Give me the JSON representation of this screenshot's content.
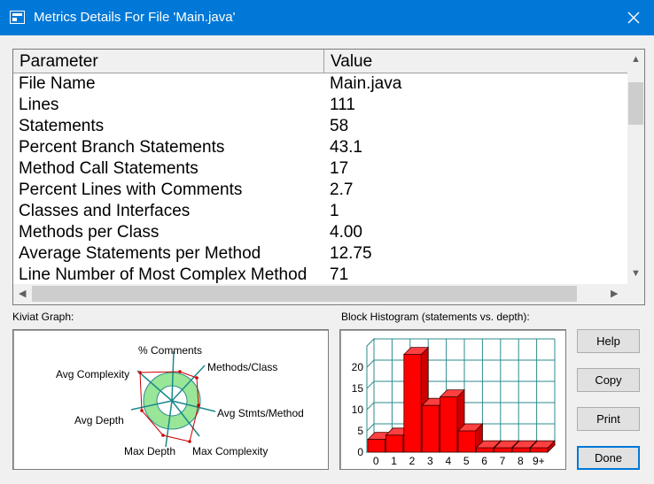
{
  "window": {
    "title": "Metrics Details For File 'Main.java'"
  },
  "grid": {
    "headers": {
      "parameter": "Parameter",
      "value": "Value"
    },
    "rows": [
      {
        "parameter": "File Name",
        "value": "Main.java"
      },
      {
        "parameter": "Lines",
        "value": "111"
      },
      {
        "parameter": "Statements",
        "value": "58"
      },
      {
        "parameter": "Percent Branch Statements",
        "value": "43.1"
      },
      {
        "parameter": "Method Call Statements",
        "value": "17"
      },
      {
        "parameter": "Percent Lines with Comments",
        "value": "2.7"
      },
      {
        "parameter": "Classes and Interfaces",
        "value": "1"
      },
      {
        "parameter": "Methods per Class",
        "value": "4.00"
      },
      {
        "parameter": "Average Statements per Method",
        "value": "12.75"
      },
      {
        "parameter": "Line Number of Most Complex Method",
        "value": "71"
      }
    ],
    "scroll": {
      "vertical_position": 0.0,
      "horizontal_position": 0.0
    }
  },
  "kiviat": {
    "label": "Kiviat Graph:",
    "axes": [
      "% Comments",
      "Methods/Class",
      "Avg Stmts/Method",
      "Max Complexity",
      "Max Depth",
      "Avg Depth",
      "Avg Complexity"
    ],
    "colors": {
      "ring": "#99e699",
      "ring_edge": "#2e8b8b",
      "axis": "#1a8a8a",
      "profile": "#cc0000"
    }
  },
  "histogram": {
    "label": "Block Histogram (statements vs. depth):",
    "colors": {
      "bar": "#ff0000",
      "grid": "#2e8b8b"
    }
  },
  "chart_data": {
    "type": "bar",
    "categories": [
      "0",
      "1",
      "2",
      "3",
      "4",
      "5",
      "6",
      "7",
      "8",
      "9+"
    ],
    "values": [
      3,
      4,
      23,
      11,
      13,
      5,
      1,
      1,
      1,
      1
    ],
    "ylim": [
      0,
      25
    ],
    "yticks": [
      "0",
      "5",
      "10",
      "15",
      "20"
    ],
    "grid": true
  },
  "buttons": {
    "help": "Help",
    "copy": "Copy",
    "print": "Print",
    "done": "Done"
  }
}
